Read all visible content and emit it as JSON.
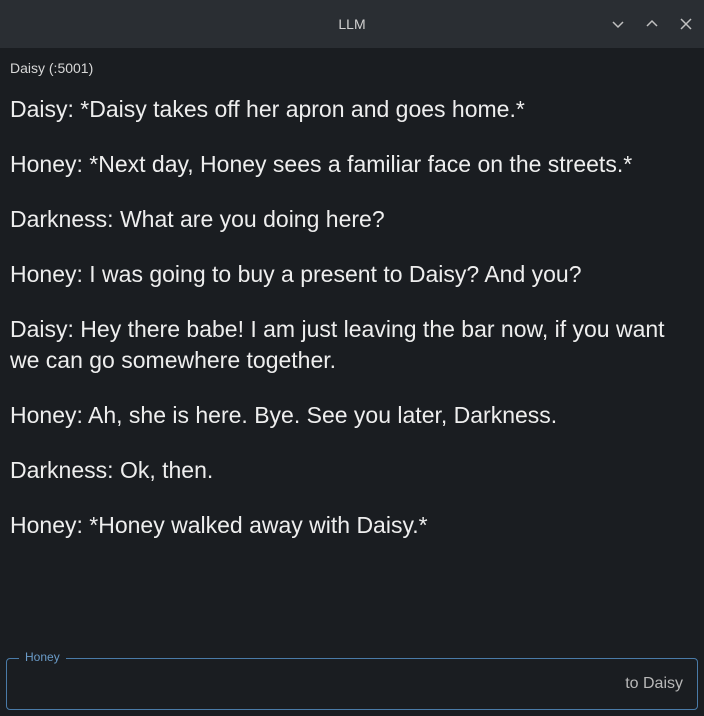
{
  "titlebar": {
    "title": "LLM"
  },
  "subtitle": "Daisy (:5001)",
  "messages": [
    {
      "speaker": "Daisy",
      "text": "*Daisy takes off her apron and goes home.*"
    },
    {
      "speaker": "Honey",
      "text": "*Next day, Honey sees a familiar face on the streets.*"
    },
    {
      "speaker": "Darkness",
      "text": "What are you doing here?"
    },
    {
      "speaker": "Honey",
      "text": "I was going to buy a present to Daisy? And you?"
    },
    {
      "speaker": "Daisy",
      "text": "Hey there babe! I am just leaving the bar now, if you want we can go somewhere together."
    },
    {
      "speaker": "Honey",
      "text": "Ah, she is here. Bye. See you later, Darkness."
    },
    {
      "speaker": "Darkness",
      "text": "Ok, then."
    },
    {
      "speaker": "Honey",
      "text": "*Honey walked away with Daisy.*"
    }
  ],
  "input": {
    "label": "Honey",
    "placeholder": "to Daisy",
    "value": ""
  }
}
